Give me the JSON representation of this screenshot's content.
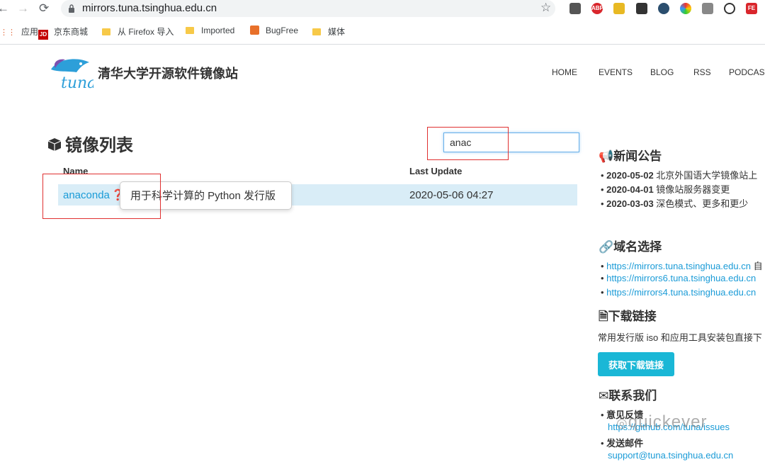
{
  "browser": {
    "url": "mirrors.tuna.tsinghua.edu.cn",
    "bookmarks": [
      "应用",
      "京东商城",
      "从 Firefox 导入",
      "Imported",
      "BugFree",
      "媒体"
    ],
    "extensions": [
      "ABP",
      "FE"
    ]
  },
  "header": {
    "site_title": "清华大学开源软件镜像站",
    "logo_text": "tuna",
    "menu": [
      "HOME",
      "EVENTS",
      "BLOG",
      "RSS",
      "PODCAST"
    ]
  },
  "mirrors": {
    "heading": "镜像列表",
    "search_value": "anac",
    "col_name": "Name",
    "col_update": "Last Update",
    "rows": [
      {
        "name": "anaconda",
        "last_update": "2020-05-06 04:27"
      }
    ],
    "tooltip": "用于科学计算的 Python 发行版"
  },
  "news": {
    "heading": "新闻公告",
    "items": [
      {
        "date": "2020-05-02",
        "text": "北京外国语大学镜像站上"
      },
      {
        "date": "2020-04-01",
        "text": "镜像站服务器变更"
      },
      {
        "date": "2020-03-03",
        "text": "深色模式、更多和更少"
      }
    ]
  },
  "domains": {
    "heading": "域名选择",
    "items": [
      "https://mirrors.tuna.tsinghua.edu.cn",
      "https://mirrors6.tuna.tsinghua.edu.cn",
      "https://mirrors4.tuna.tsinghua.edu.cn"
    ],
    "suffix": "自"
  },
  "downloads": {
    "heading": "下载链接",
    "desc": "常用发行版 iso 和应用工具安装包直接下",
    "button": "获取下载链接"
  },
  "contact": {
    "heading": "联系我们",
    "feedback_label": "意见反馈",
    "feedback_link": "https://github.com/tuna/issues",
    "email_label": "发送邮件",
    "email": "support@tuna.tsinghua.edu.cn"
  },
  "watermark": "quickever",
  "colors": {
    "accent": "#1a9bd7",
    "button": "#1ab7d6",
    "row_highlight": "#d9edf7",
    "annotation": "#e03030"
  }
}
